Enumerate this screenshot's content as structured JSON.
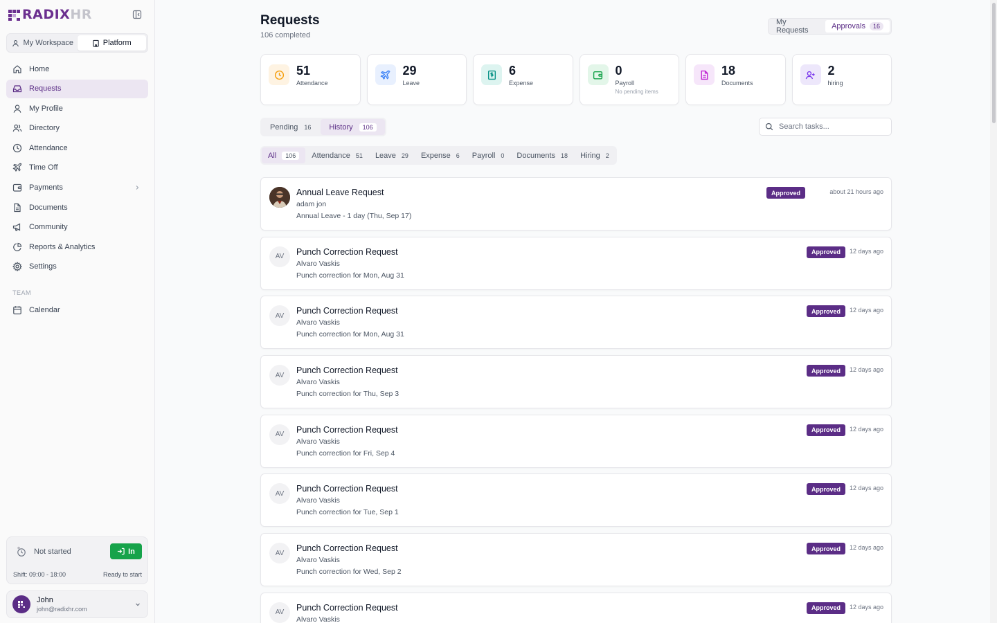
{
  "app": {
    "logo_main": "RADIX",
    "logo_hr": "HR"
  },
  "workspace_toggle": {
    "options": [
      {
        "label": "My Workspace",
        "icon": "user-icon"
      },
      {
        "label": "Platform",
        "icon": "building-icon"
      }
    ],
    "active": "Platform"
  },
  "nav": {
    "items": [
      {
        "label": "Home",
        "icon": "home-icon"
      },
      {
        "label": "Requests",
        "icon": "inbox-icon",
        "active": true
      },
      {
        "label": "My Profile",
        "icon": "user-icon"
      },
      {
        "label": "Directory",
        "icon": "users-icon"
      },
      {
        "label": "Attendance",
        "icon": "clock-icon"
      },
      {
        "label": "Time Off",
        "icon": "plane-icon"
      },
      {
        "label": "Payments",
        "icon": "wallet-icon",
        "has_children": true
      },
      {
        "label": "Documents",
        "icon": "file-icon"
      },
      {
        "label": "Community",
        "icon": "megaphone-icon"
      },
      {
        "label": "Reports & Analytics",
        "icon": "chart-pie-icon"
      },
      {
        "label": "Settings",
        "icon": "gear-icon"
      }
    ],
    "team_label": "TEAM",
    "team_items": [
      {
        "label": "Calendar",
        "icon": "calendar-icon"
      }
    ]
  },
  "clock": {
    "status": "Not started",
    "button": "In",
    "shift": "Shift: 09:00 - 18:00",
    "ready": "Ready to start"
  },
  "user": {
    "name": "John",
    "email": "john@radixhr.com"
  },
  "header": {
    "title": "Requests",
    "subtitle": "106 completed"
  },
  "top_toggle": {
    "my_requests": "My Requests",
    "approvals": "Approvals",
    "approvals_count": "16"
  },
  "stats": [
    {
      "value": "51",
      "label": "Attendance",
      "note": "",
      "icon": "clock-icon",
      "color": "#f59e0b",
      "bg": "#fef3e2"
    },
    {
      "value": "29",
      "label": "Leave",
      "note": "",
      "icon": "plane-icon",
      "color": "#3b82f6",
      "bg": "#e8f0fe"
    },
    {
      "value": "6",
      "label": "Expense",
      "note": "",
      "icon": "dollar-doc-icon",
      "color": "#0d9488",
      "bg": "#ddf4f0"
    },
    {
      "value": "0",
      "label": "Payroll",
      "note": "No pending items",
      "icon": "wallet-icon",
      "color": "#16a34a",
      "bg": "#e3f6e9"
    },
    {
      "value": "18",
      "label": "Documents",
      "note": "",
      "icon": "file-icon",
      "color": "#c026d3",
      "bg": "#f6e6fa"
    },
    {
      "value": "2",
      "label": "hiring",
      "note": "",
      "icon": "user-plus-icon",
      "color": "#7c3aed",
      "bg": "#ede7fb"
    }
  ],
  "status_tabs": [
    {
      "label": "Pending",
      "count": "16"
    },
    {
      "label": "History",
      "count": "106",
      "active": true
    }
  ],
  "search": {
    "placeholder": "Search tasks..."
  },
  "category_tabs": [
    {
      "label": "All",
      "count": "106",
      "active": true
    },
    {
      "label": "Attendance",
      "count": "51"
    },
    {
      "label": "Leave",
      "count": "29"
    },
    {
      "label": "Expense",
      "count": "6"
    },
    {
      "label": "Payroll",
      "count": "0"
    },
    {
      "label": "Documents",
      "count": "18"
    },
    {
      "label": "Hiring",
      "count": "2"
    }
  ],
  "requests": [
    {
      "title": "Annual Leave Request",
      "person": "adam jon",
      "desc": "Annual Leave - 1 day (Thu, Sep 17)",
      "status": "Approved",
      "time": "about 21 hours ago",
      "avatar": "",
      "photo": true
    },
    {
      "title": "Punch Correction Request",
      "person": "Alvaro Vaskis",
      "desc": "Punch correction for Mon, Aug 31",
      "status": "Approved",
      "time": "12 days ago",
      "avatar": "AV"
    },
    {
      "title": "Punch Correction Request",
      "person": "Alvaro Vaskis",
      "desc": "Punch correction for Mon, Aug 31",
      "status": "Approved",
      "time": "12 days ago",
      "avatar": "AV"
    },
    {
      "title": "Punch Correction Request",
      "person": "Alvaro Vaskis",
      "desc": "Punch correction for Thu, Sep 3",
      "status": "Approved",
      "time": "12 days ago",
      "avatar": "AV"
    },
    {
      "title": "Punch Correction Request",
      "person": "Alvaro Vaskis",
      "desc": "Punch correction for Fri, Sep 4",
      "status": "Approved",
      "time": "12 days ago",
      "avatar": "AV"
    },
    {
      "title": "Punch Correction Request",
      "person": "Alvaro Vaskis",
      "desc": "Punch correction for Tue, Sep 1",
      "status": "Approved",
      "time": "12 days ago",
      "avatar": "AV"
    },
    {
      "title": "Punch Correction Request",
      "person": "Alvaro Vaskis",
      "desc": "Punch correction for Wed, Sep 2",
      "status": "Approved",
      "time": "12 days ago",
      "avatar": "AV"
    },
    {
      "title": "Punch Correction Request",
      "person": "Alvaro Vaskis",
      "desc": "",
      "status": "Approved",
      "time": "12 days ago",
      "avatar": "AV"
    }
  ]
}
